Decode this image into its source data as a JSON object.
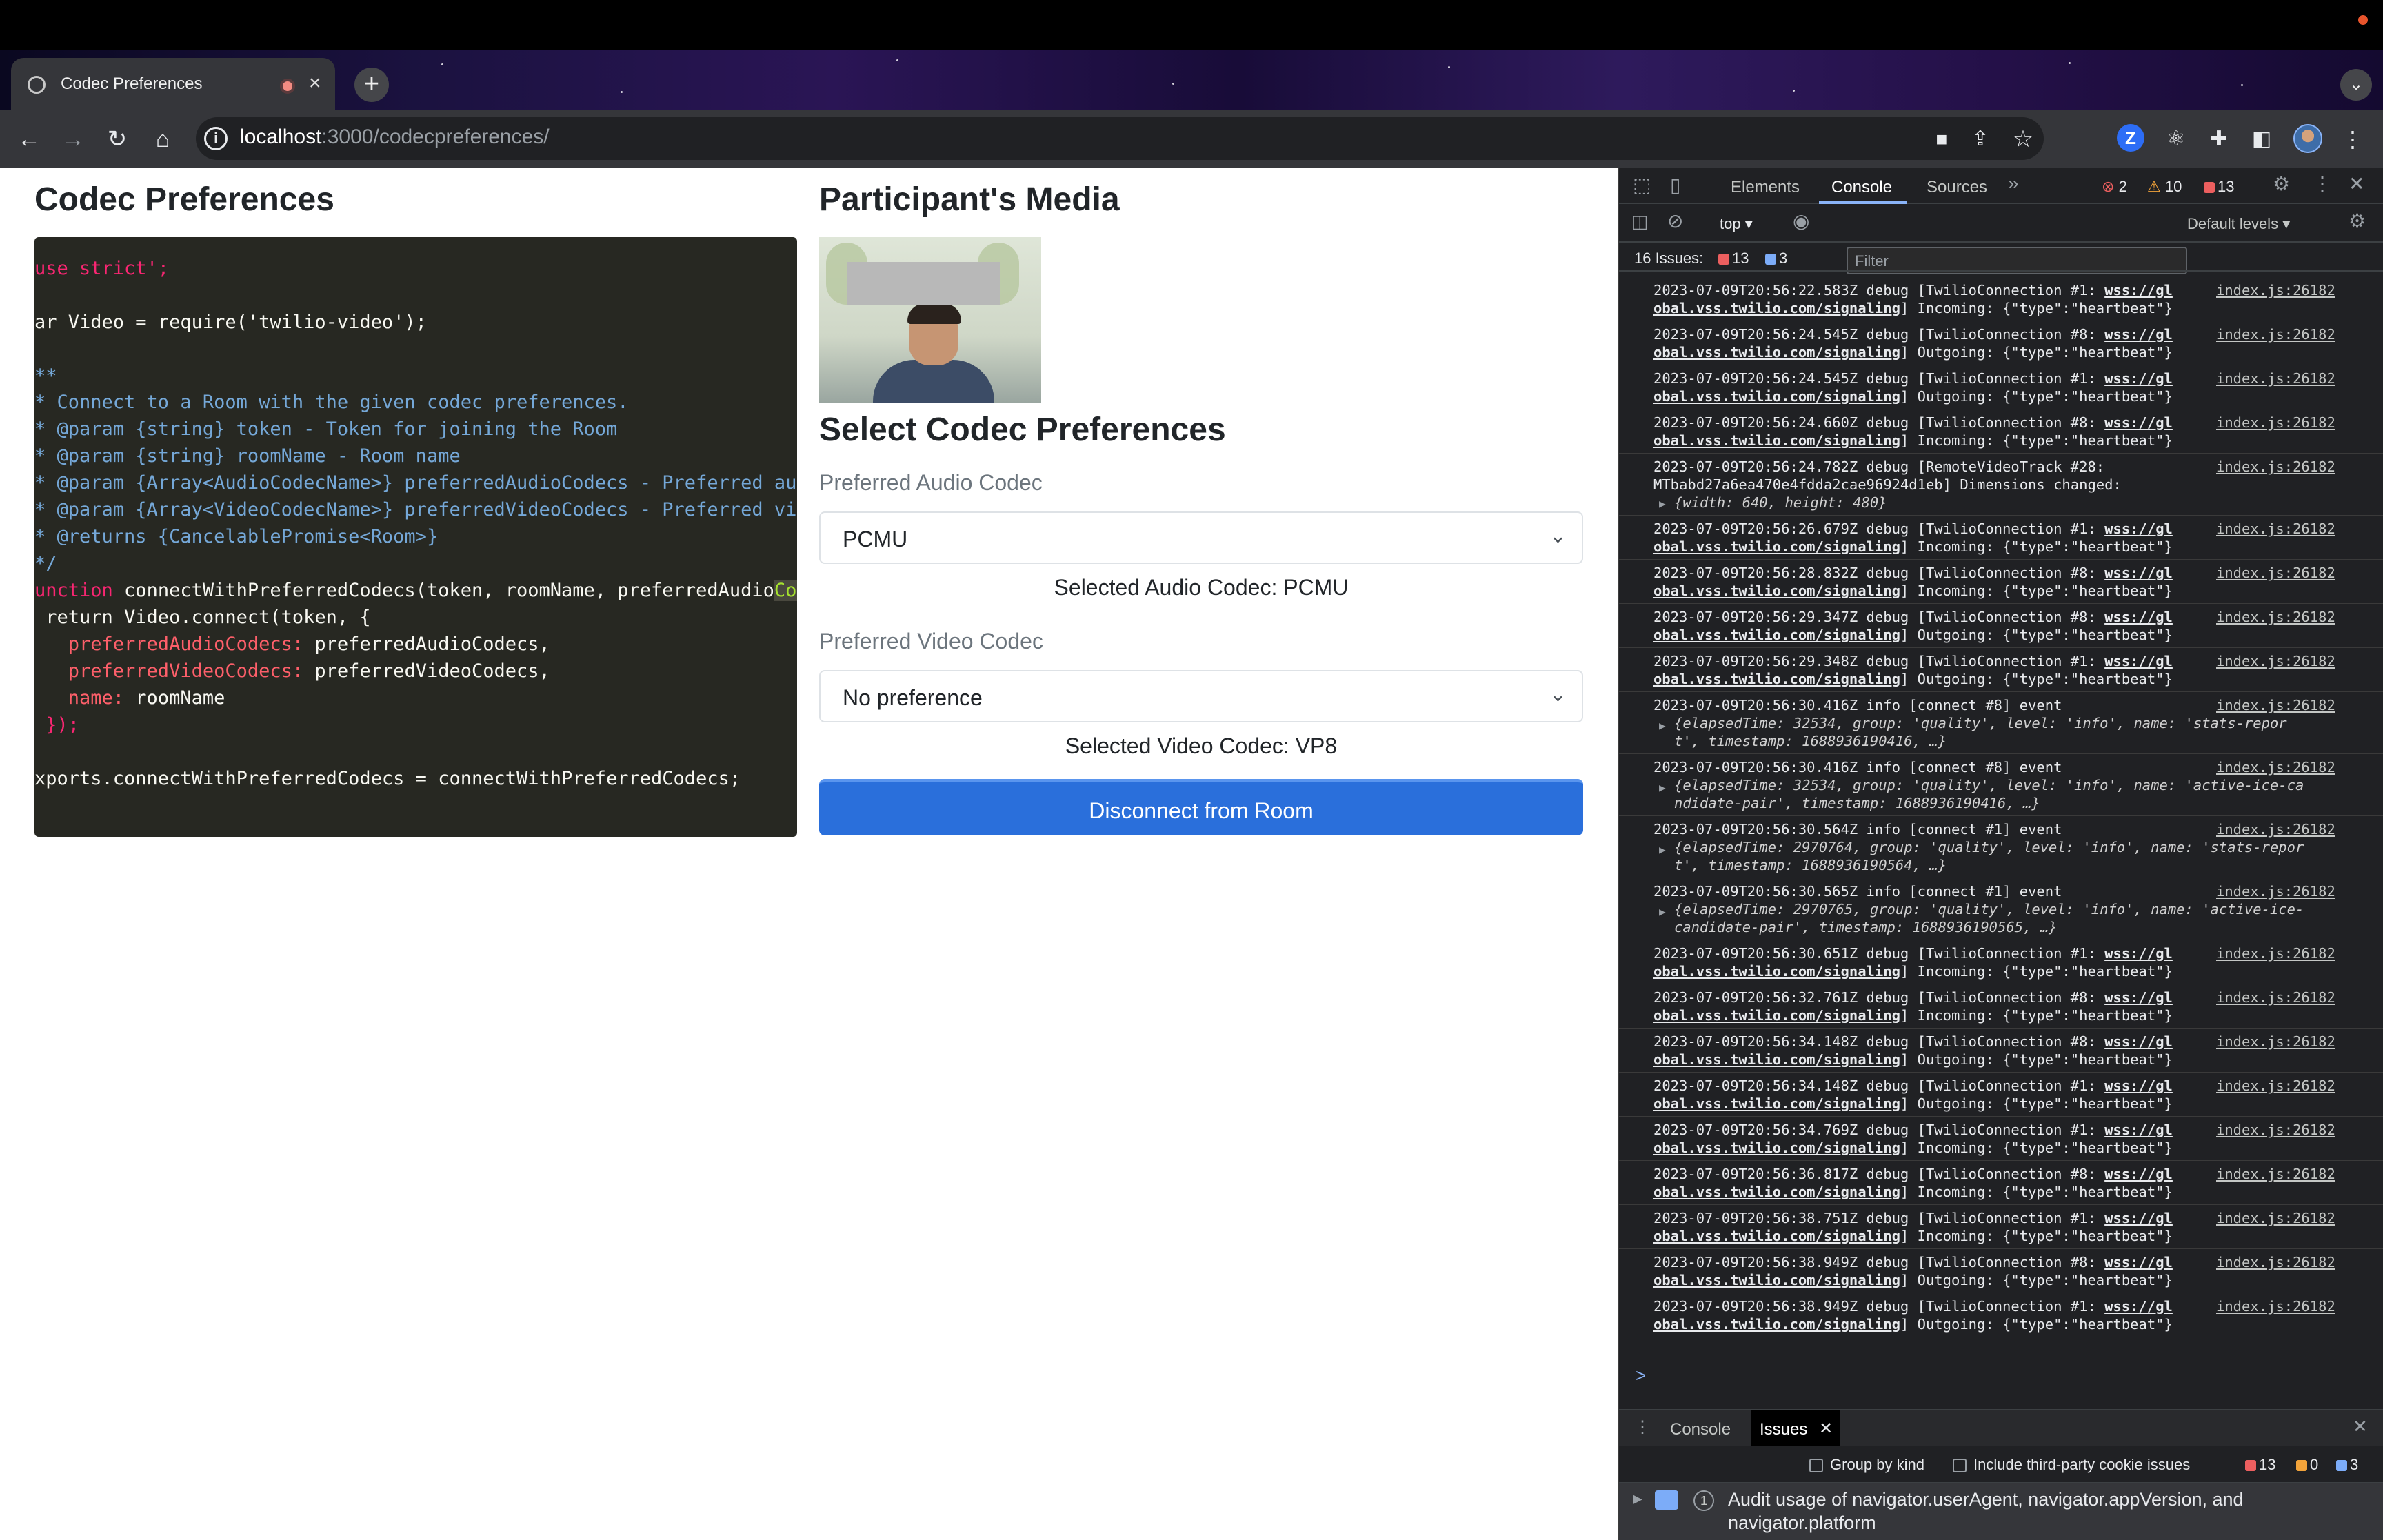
{
  "browser": {
    "tab_title": "Codec Preferences",
    "url_host": "localhost",
    "url_path": ":3000/codecpreferences/"
  },
  "page": {
    "left_title": "Codec Preferences",
    "right_title": "Participant's Media",
    "select_title": "Select Codec Preferences",
    "audio_label": "Preferred Audio Codec",
    "audio_value": "PCMU",
    "audio_selected": "Selected Audio Codec: PCMU",
    "video_label": "Preferred Video Codec",
    "video_value": "No preference",
    "video_selected": "Selected Video Codec: VP8",
    "disconnect_label": "Disconnect from Room"
  },
  "code": {
    "l1": "use strict';",
    "l2": "ar Video = require('twilio-video');",
    "l3": "**",
    "l4": "* Connect to a Room with the given codec preferences.",
    "l5": "* @param {string} token - Token for joining the Room",
    "l6": "* @param {string} roomName - Room name",
    "l7": "* @param {Array<AudioCodecName>} preferredAudioCodecs - Preferred audio",
    "l8": "* @param {Array<VideoCodecName>} preferredVideoCodecs - Preferred video",
    "l9": "* @returns {CancelablePromise<Room>}",
    "l10": "*/",
    "l11a": "unction",
    "l11b": " connectWithPreferredCodecs(token, roomName, preferredAudio",
    "l11c": "Codec",
    "l12": " return Video.connect(token, {",
    "l13a": "   preferredAudioCodecs:",
    "l13b": " preferredAudioCodecs,",
    "l14a": "   preferredVideoCodecs:",
    "l14b": " preferredVideoCodecs,",
    "l15a": "   name:",
    "l15b": " roomName",
    "l16": " });",
    "l18": "xports.connectWithPreferredCodecs = connectWithPreferredCodecs;"
  },
  "devtools": {
    "tabs": [
      "Elements",
      "Console",
      "Sources"
    ],
    "errors": "2",
    "warnings": "10",
    "issues_count": "13",
    "context": "top",
    "filter_placeholder": "Filter",
    "levels": "Default levels",
    "issues_bar": "16 Issues:",
    "issues_red": "13",
    "issues_blue": "3",
    "prompt": ">",
    "logs": [
      {
        "l1a": "2023-07-09T20:56:22.583Z debug [TwilioConnection #1: ",
        "l1u": "wss://gl",
        "l2u": "obal.vss.twilio.com/signaling",
        "l2b": "] Incoming: {\"type\":\"heartbeat\"}"
      },
      {
        "l1a": "2023-07-09T20:56:24.545Z debug [TwilioConnection #8: ",
        "l1u": "wss://gl",
        "l2u": "obal.vss.twilio.com/signaling",
        "l2b": "] Outgoing: {\"type\":\"heartbeat\"}"
      },
      {
        "l1a": "2023-07-09T20:56:24.545Z debug [TwilioConnection #1: ",
        "l1u": "wss://gl",
        "l2u": "obal.vss.twilio.com/signaling",
        "l2b": "] Outgoing: {\"type\":\"heartbeat\"}"
      },
      {
        "l1a": "2023-07-09T20:56:24.660Z debug [TwilioConnection #8: ",
        "l1u": "wss://gl",
        "l2u": "obal.vss.twilio.com/signaling",
        "l2b": "] Incoming: {\"type\":\"heartbeat\"}"
      }
    ],
    "log_track_1": "2023-07-09T20:56:24.782Z debug [RemoteVideoTrack #28:",
    "log_track_2": "MTbabd27a6ea470e4fdda2cae96924d1eb] Dimensions changed:",
    "log_track_3": "{width: 640, height: 480}",
    "logs2": [
      {
        "l1a": "2023-07-09T20:56:26.679Z debug [TwilioConnection #1: ",
        "l1u": "wss://gl",
        "l2u": "obal.vss.twilio.com/signaling",
        "l2b": "] Incoming: {\"type\":\"heartbeat\"}"
      },
      {
        "l1a": "2023-07-09T20:56:28.832Z debug [TwilioConnection #8: ",
        "l1u": "wss://gl",
        "l2u": "obal.vss.twilio.com/signaling",
        "l2b": "] Incoming: {\"type\":\"heartbeat\"}"
      },
      {
        "l1a": "2023-07-09T20:56:29.347Z debug [TwilioConnection #8: ",
        "l1u": "wss://gl",
        "l2u": "obal.vss.twilio.com/signaling",
        "l2b": "] Outgoing: {\"type\":\"heartbeat\"}"
      },
      {
        "l1a": "2023-07-09T20:56:29.348Z debug [TwilioConnection #1: ",
        "l1u": "wss://gl",
        "l2u": "obal.vss.twilio.com/signaling",
        "l2b": "] Outgoing: {\"type\":\"heartbeat\"}"
      }
    ],
    "events": [
      {
        "head": "2023-07-09T20:56:30.416Z info [connect #8] event",
        "o1": "{elapsedTime: 32534, group: 'quality', level: 'info', name: 'stats-repor",
        "o2": "t', timestamp: 1688936190416, …}"
      },
      {
        "head": "2023-07-09T20:56:30.416Z info [connect #8] event",
        "o1": "{elapsedTime: 32534, group: 'quality', level: 'info', name: 'active-ice-ca",
        "o2": "ndidate-pair', timestamp: 1688936190416, …}"
      },
      {
        "head": "2023-07-09T20:56:30.564Z info [connect #1] event",
        "o1": "{elapsedTime: 2970764, group: 'quality', level: 'info', name: 'stats-repor",
        "o2": "t', timestamp: 1688936190564, …}"
      },
      {
        "head": "2023-07-09T20:56:30.565Z info [connect #1] event",
        "o1": "{elapsedTime: 2970765, group: 'quality', level: 'info', name: 'active-ice-",
        "o2": "candidate-pair', timestamp: 1688936190565, …}"
      }
    ],
    "logs3": [
      {
        "l1a": "2023-07-09T20:56:30.651Z debug [TwilioConnection #1: ",
        "l1u": "wss://gl",
        "l2u": "obal.vss.twilio.com/signaling",
        "l2b": "] Incoming: {\"type\":\"heartbeat\"}"
      },
      {
        "l1a": "2023-07-09T20:56:32.761Z debug [TwilioConnection #8: ",
        "l1u": "wss://gl",
        "l2u": "obal.vss.twilio.com/signaling",
        "l2b": "] Incoming: {\"type\":\"heartbeat\"}"
      },
      {
        "l1a": "2023-07-09T20:56:34.148Z debug [TwilioConnection #8: ",
        "l1u": "wss://gl",
        "l2u": "obal.vss.twilio.com/signaling",
        "l2b": "] Outgoing: {\"type\":\"heartbeat\"}"
      },
      {
        "l1a": "2023-07-09T20:56:34.148Z debug [TwilioConnection #1: ",
        "l1u": "wss://gl",
        "l2u": "obal.vss.twilio.com/signaling",
        "l2b": "] Outgoing: {\"type\":\"heartbeat\"}"
      },
      {
        "l1a": "2023-07-09T20:56:34.769Z debug [TwilioConnection #1: ",
        "l1u": "wss://gl",
        "l2u": "obal.vss.twilio.com/signaling",
        "l2b": "] Incoming: {\"type\":\"heartbeat\"}"
      },
      {
        "l1a": "2023-07-09T20:56:36.817Z debug [TwilioConnection #8: ",
        "l1u": "wss://gl",
        "l2u": "obal.vss.twilio.com/signaling",
        "l2b": "] Incoming: {\"type\":\"heartbeat\"}"
      },
      {
        "l1a": "2023-07-09T20:56:38.751Z debug [TwilioConnection #1: ",
        "l1u": "wss://gl",
        "l2u": "obal.vss.twilio.com/signaling",
        "l2b": "] Incoming: {\"type\":\"heartbeat\"}"
      },
      {
        "l1a": "2023-07-09T20:56:38.949Z debug [TwilioConnection #8: ",
        "l1u": "wss://gl",
        "l2u": "obal.vss.twilio.com/signaling",
        "l2b": "] Outgoing: {\"type\":\"heartbeat\"}"
      },
      {
        "l1a": "2023-07-09T20:56:38.949Z debug [TwilioConnection #1: ",
        "l1u": "wss://gl",
        "l2u": "obal.vss.twilio.com/signaling",
        "l2b": "] Outgoing: {\"type\":\"heartbeat\"}"
      }
    ],
    "log_source": "index.js:26182",
    "drawer_tabs": [
      "Console",
      "Issues"
    ],
    "group_by_kind": "Group by kind",
    "third_party": "Include third-party cookie issues",
    "drawer_red": "13",
    "drawer_orange": "0",
    "drawer_blue": "3",
    "issue_count": "1",
    "issue_text_1": "Audit usage of navigator.userAgent, navigator.appVersion, and",
    "issue_text_2": "navigator.platform"
  }
}
